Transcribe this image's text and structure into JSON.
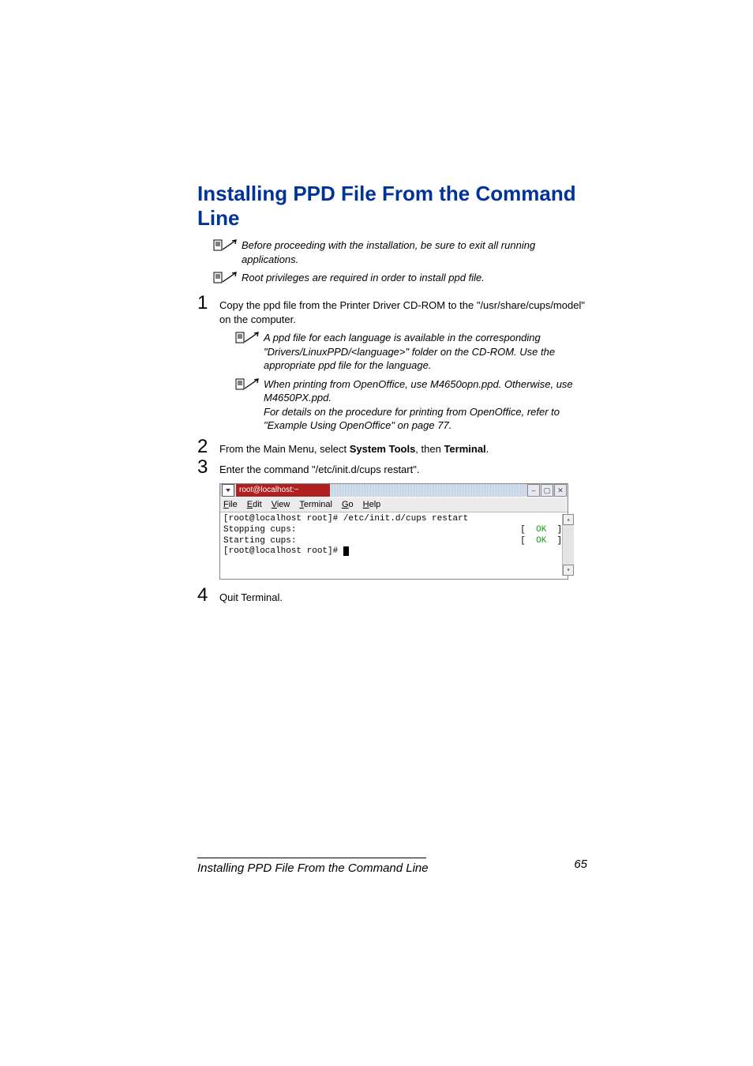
{
  "title": "Installing PPD File From the Command Line",
  "notes": {
    "intro1": "Before proceeding with the installation, be sure to exit all running applications.",
    "intro2": "Root privileges are required in order to install ppd file.",
    "lang": "A ppd file for each language is available in the corresponding \"Drivers/LinuxPPD/<language>\" folder on the CD-ROM. Use the appropriate ppd file for the language.",
    "openoffice_a": "When printing from OpenOffice, use M4650opn.ppd. Otherwise, use M4650PX.ppd.",
    "openoffice_b": "For details on the procedure for printing from OpenOffice, refer to \"Example Using OpenOffice\" on page 77."
  },
  "steps": {
    "s1": "Copy the ppd file from the Printer Driver CD-ROM to the \"/usr/share/cups/model\" on the computer.",
    "s2_a": "From the Main Menu, select ",
    "s2_b": "System Tools",
    "s2_c": ", then ",
    "s2_d": "Terminal",
    "s2_e": ".",
    "s3": "Enter the command \"/etc/init.d/cups restart\".",
    "s4": "Quit Terminal."
  },
  "terminal": {
    "title": "root@localhost:~",
    "menu": {
      "file": "File",
      "edit": "Edit",
      "view": "View",
      "terminal": "Terminal",
      "go": "Go",
      "help": "Help"
    },
    "line1": "[root@localhost root]# /etc/init.d/cups restart",
    "line2a": "Stopping cups:",
    "line2b": "[  ",
    "line2ok": "OK",
    "line2c": "  ]",
    "line3a": "Starting cups:",
    "line3b": "[  ",
    "line3ok": "OK",
    "line3c": "  ]",
    "line4": "[root@localhost root]# "
  },
  "footer": {
    "left": "Installing PPD File From the Command Line",
    "right": "65"
  }
}
